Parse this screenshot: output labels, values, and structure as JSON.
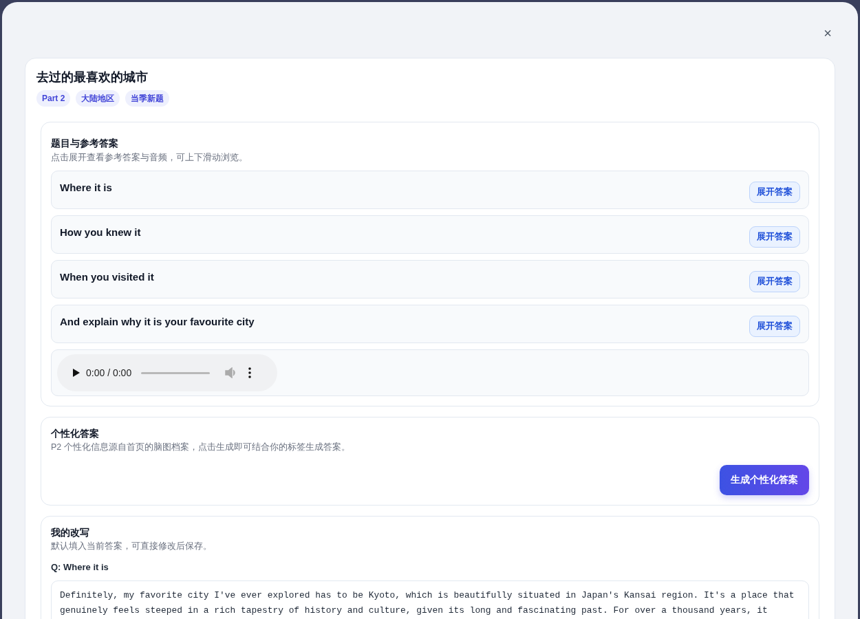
{
  "modal": {
    "close": "×"
  },
  "card": {
    "title": "去过的最喜欢的城市",
    "tags": [
      "Part 2",
      "大陆地区",
      "当季新题"
    ]
  },
  "reference": {
    "heading": "题目与参考答案",
    "hint": "点击展开查看参考答案与音频，可上下滑动浏览。",
    "questions": [
      {
        "text": "Where it is",
        "button": "展开答案",
        "expanded": false
      },
      {
        "text": "How you knew it",
        "button": "展开答案",
        "expanded": false
      },
      {
        "text": "When you visited it",
        "button": "展开答案",
        "expanded": false
      },
      {
        "text": "And explain why it is your favourite city",
        "button": "展开答案",
        "expanded": false
      }
    ],
    "audio": {
      "time": "0:00 / 0:00"
    }
  },
  "personal": {
    "heading": "个性化答案",
    "hint": "P2 个性化信息源自首页的脑图档案，点击生成即可结合你的标签生成答案。",
    "button": "生成个性化答案"
  },
  "rewrite": {
    "heading": "我的改写",
    "hint": "默认填入当前答案，可直接修改后保存。",
    "question": "Q: Where it is",
    "answer": "Definitely, my favorite city I've ever explored has to be Kyoto, which is beautifully situated in Japan's Kansai region. It's a place that genuinely feels steeped in a rich tapestry of history and culture, given its long and fascinating past. For over a thousand years, it"
  }
}
